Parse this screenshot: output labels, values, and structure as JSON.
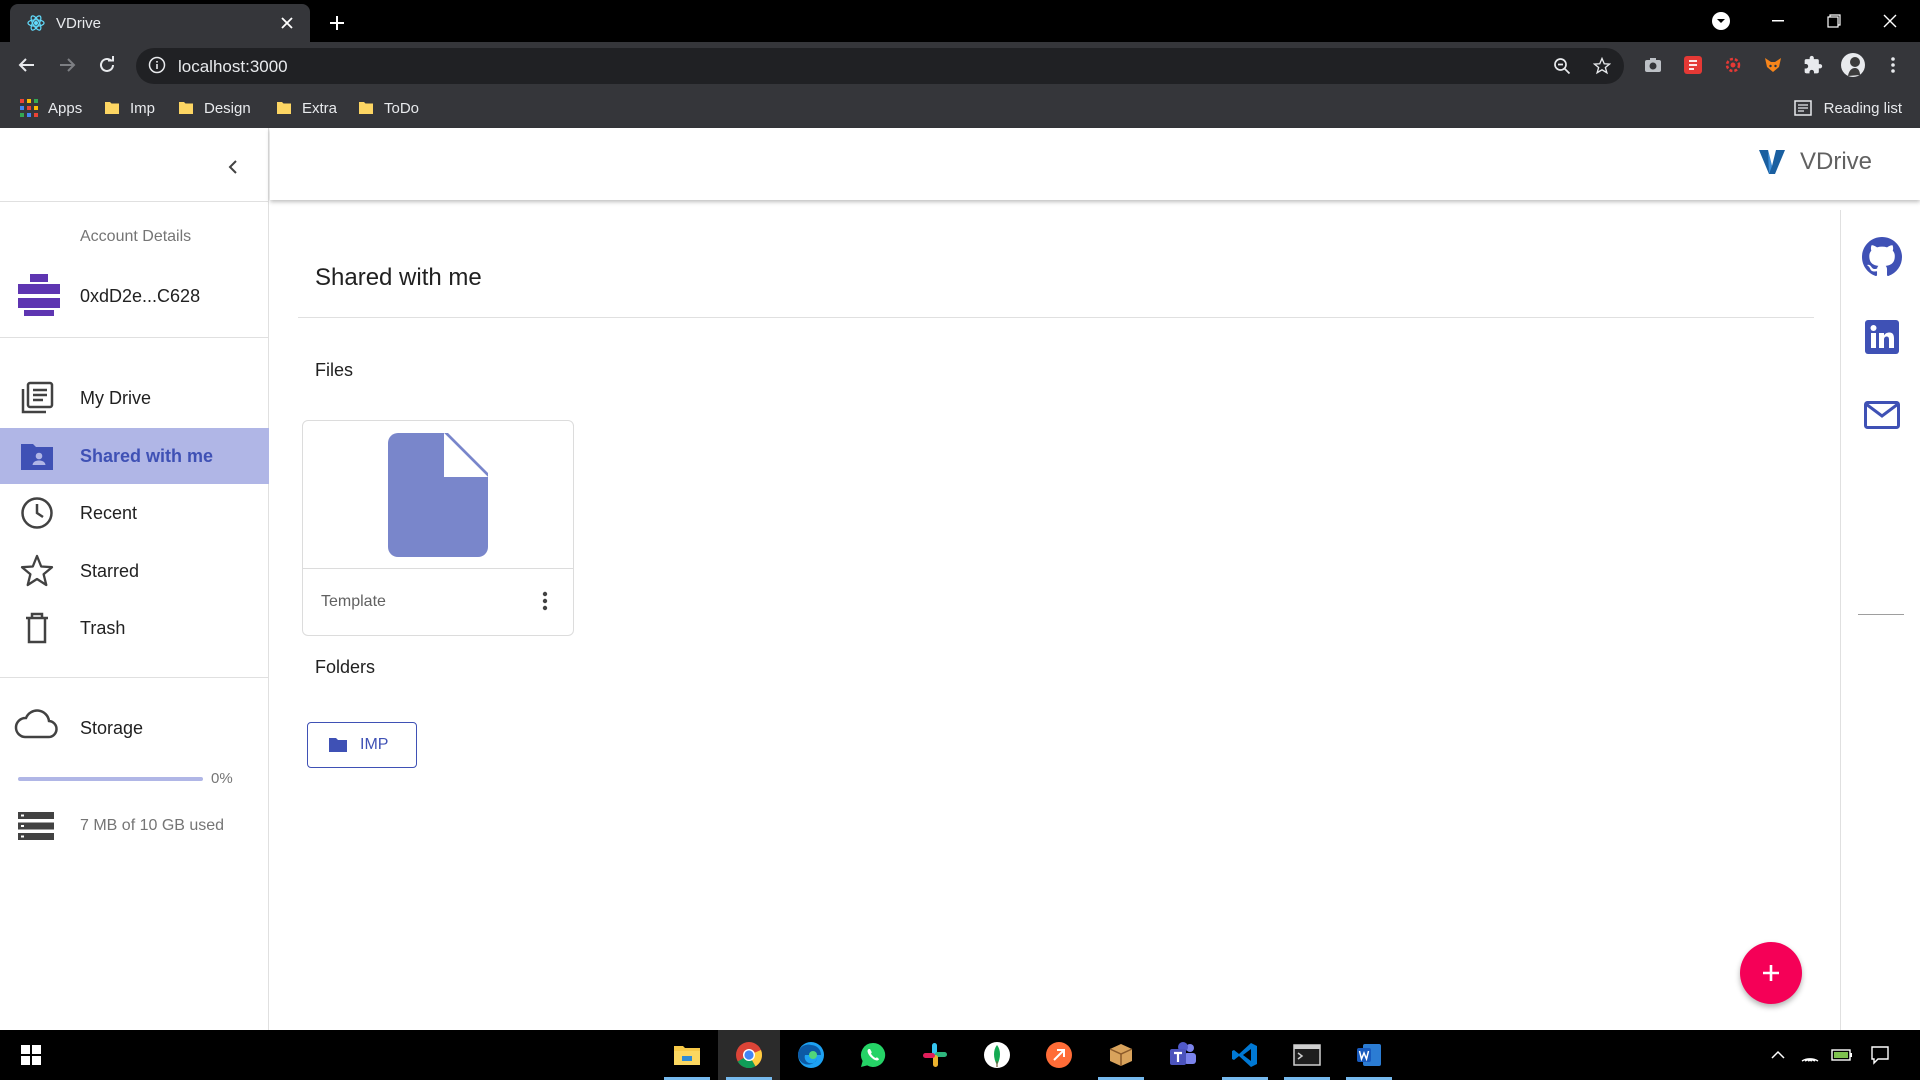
{
  "browser": {
    "tab_title": "VDrive",
    "url": "localhost:3000",
    "bookmarks": [
      "Apps",
      "Imp",
      "Design",
      "Extra",
      "ToDo"
    ],
    "reading_list": "Reading list"
  },
  "sidebar": {
    "account_label": "Account Details",
    "account_address": "0xdD2e...C628",
    "nav": [
      {
        "label": "My Drive",
        "icon": "drive-icon"
      },
      {
        "label": "Shared with me",
        "icon": "shared-folder-icon",
        "active": true
      },
      {
        "label": "Recent",
        "icon": "clock-icon"
      },
      {
        "label": "Starred",
        "icon": "star-icon"
      },
      {
        "label": "Trash",
        "icon": "trash-icon"
      }
    ],
    "storage": {
      "label": "Storage",
      "percent_label": "0%",
      "percent_value": 0,
      "used_text": "7 MB of 10 GB used"
    }
  },
  "header": {
    "brand": "VDrive"
  },
  "main": {
    "title": "Shared with me",
    "files_label": "Files",
    "files": [
      {
        "name": "Template"
      }
    ],
    "folders_label": "Folders",
    "folders": [
      {
        "name": "IMP"
      }
    ]
  },
  "colors": {
    "primary": "#3f51b5",
    "active_nav_bg": "#b0b6e6",
    "fab": "#f50057",
    "file_icon": "#7986cb"
  }
}
